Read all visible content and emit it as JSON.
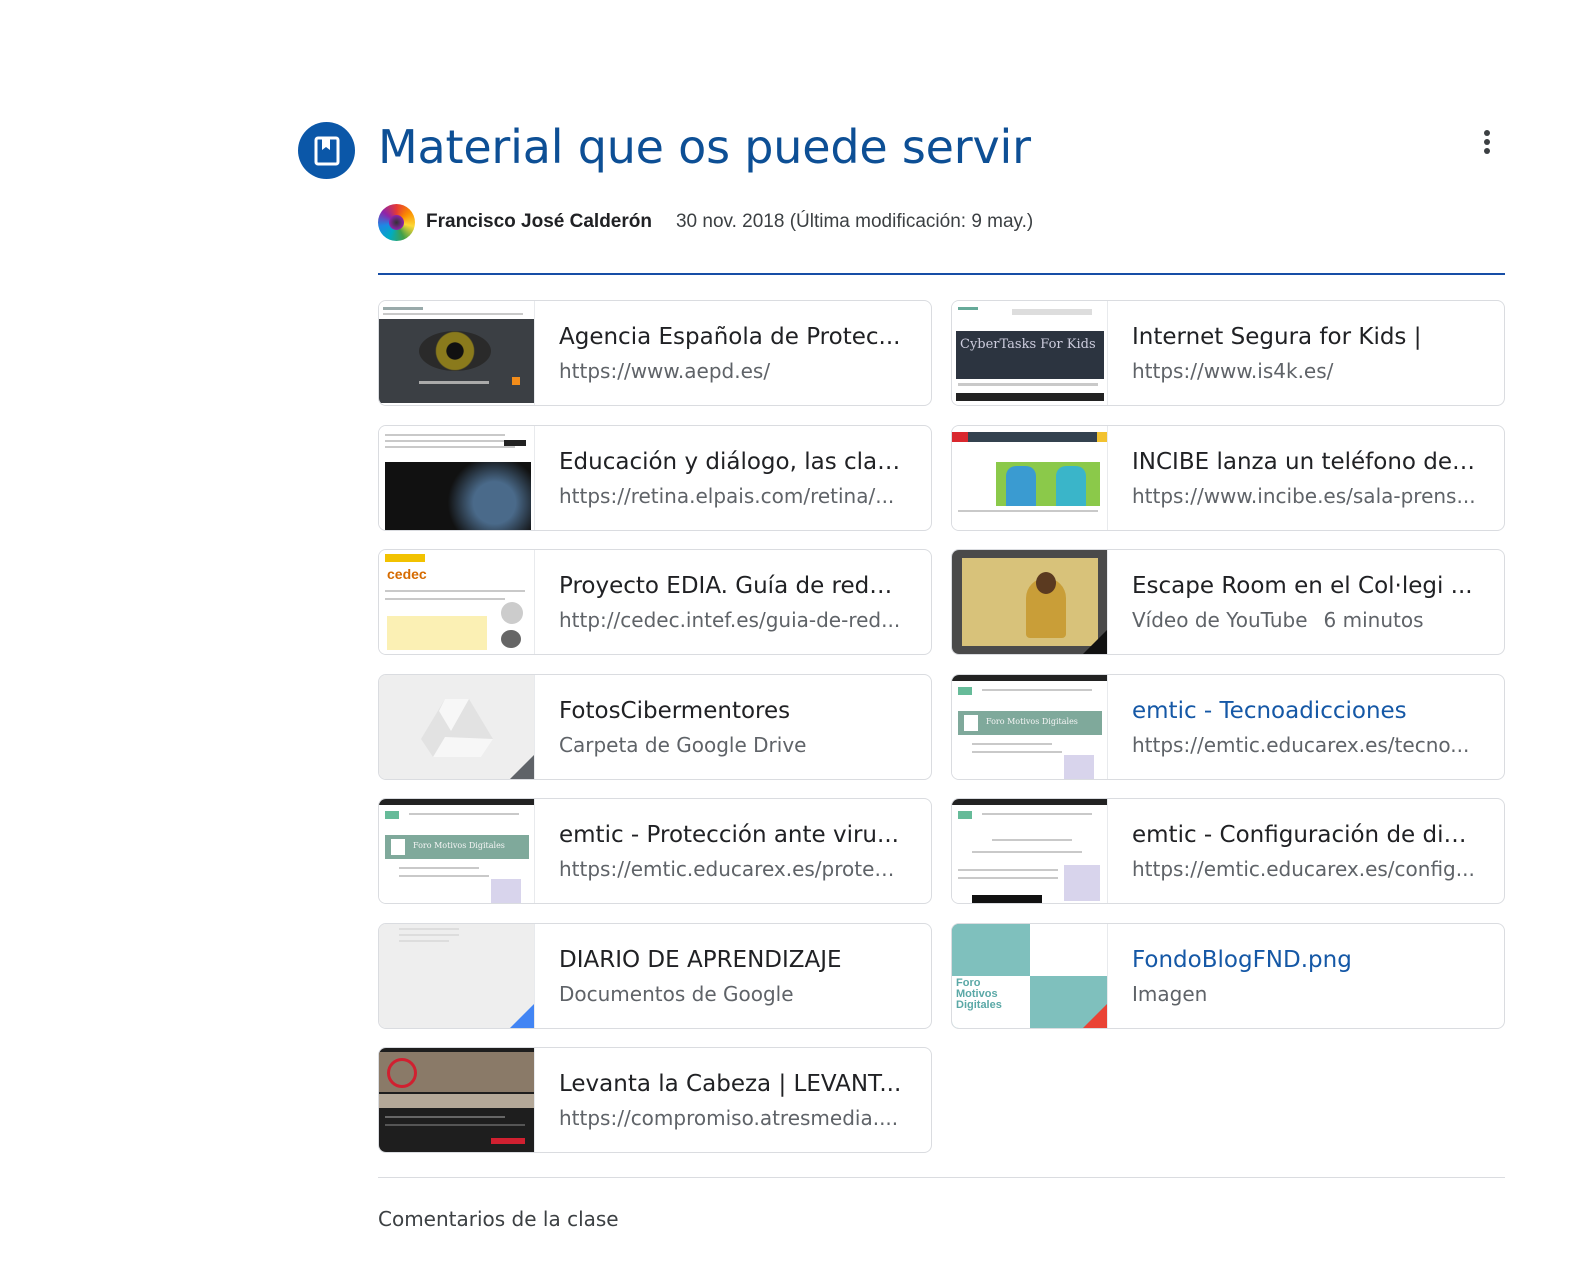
{
  "header": {
    "title": "Material que os puede servir",
    "icon": "bookmark-icon",
    "accent": "#0b57a8"
  },
  "author": {
    "name": "Francisco José Calderón",
    "date": "30 nov. 2018 (Última modificación: 9 may.)"
  },
  "materials": [
    {
      "title": "Agencia Española de Protec...",
      "subtitle": "https://www.aepd.es/",
      "thumb": "aepd"
    },
    {
      "title": "Internet Segura for Kids |",
      "subtitle": "https://www.is4k.es/",
      "thumb": "is4k"
    },
    {
      "title": "Educación y diálogo, las clav...",
      "subtitle": "https://retina.elpais.com/retina/...",
      "thumb": "retina"
    },
    {
      "title": "INCIBE lanza un teléfono de ...",
      "subtitle": "https://www.incibe.es/sala-prens...",
      "thumb": "incibe"
    },
    {
      "title": "Proyecto EDIA. Guía de rede...",
      "subtitle": "http://cedec.intef.es/guia-de-red...",
      "thumb": "cedec"
    },
    {
      "title": "Escape Room en el Col·legi ...",
      "subtitle": "Vídeo de YouTube",
      "subtitle_extra": "6 minutos",
      "thumb": "youtube"
    },
    {
      "title": "FotosCibermentores",
      "subtitle": "Carpeta de Google Drive",
      "thumb": "drive"
    },
    {
      "title": "emtic - Tecnoadicciones",
      "subtitle": "https://emtic.educarex.es/tecno...",
      "thumb": "emtic"
    },
    {
      "title": "emtic - Protección ante viru...",
      "subtitle": "https://emtic.educarex.es/protec...",
      "thumb": "emtic"
    },
    {
      "title": "emtic - Configuración de dis...",
      "subtitle": "https://emtic.educarex.es/config...",
      "thumb": "emtic2"
    },
    {
      "title": "DIARIO DE APRENDIZAJE",
      "subtitle": "Documentos de Google",
      "thumb": "gdoc"
    },
    {
      "title": "FondoBlogFND.png",
      "subtitle": "Imagen",
      "thumb": "png"
    },
    {
      "title": "Levanta la Cabeza | LEVANT...",
      "subtitle": "https://compromiso.atresmedia....",
      "thumb": "atres"
    }
  ],
  "comments_label": "Comentarios de la clase"
}
